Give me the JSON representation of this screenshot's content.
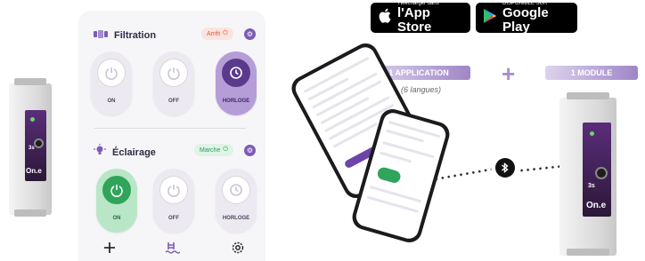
{
  "app_panel": {
    "filtration": {
      "title": "Filtration",
      "status": "Arrêt",
      "buttons": [
        {
          "label": "ON",
          "active": false
        },
        {
          "label": "OFF",
          "active": false
        },
        {
          "label": "HORLOGE",
          "active": true
        }
      ]
    },
    "eclairage": {
      "title": "Éclairage",
      "status": "Marche",
      "buttons": [
        {
          "label": "ON",
          "active": true
        },
        {
          "label": "OFF",
          "active": false
        },
        {
          "label": "HORLOGE",
          "active": false
        }
      ]
    },
    "nav": [
      "plus-icon",
      "pool-ladder-icon",
      "gear-icon"
    ]
  },
  "stores": {
    "apple": {
      "small": "Télécharger dans",
      "big": "l'App Store"
    },
    "google": {
      "small": "DISPONIBLE SUR",
      "big": "Google Play"
    }
  },
  "features": {
    "app_pill": "1 APPLICATION",
    "languages": "(6 langues)",
    "plus": "+",
    "module_pill": "1 MODULE"
  },
  "module": {
    "brand": "On.e",
    "button_label": "3s"
  },
  "colors": {
    "purple": "#5b3a8c",
    "green": "#2fa45a",
    "off_red": "#d65c3c"
  }
}
